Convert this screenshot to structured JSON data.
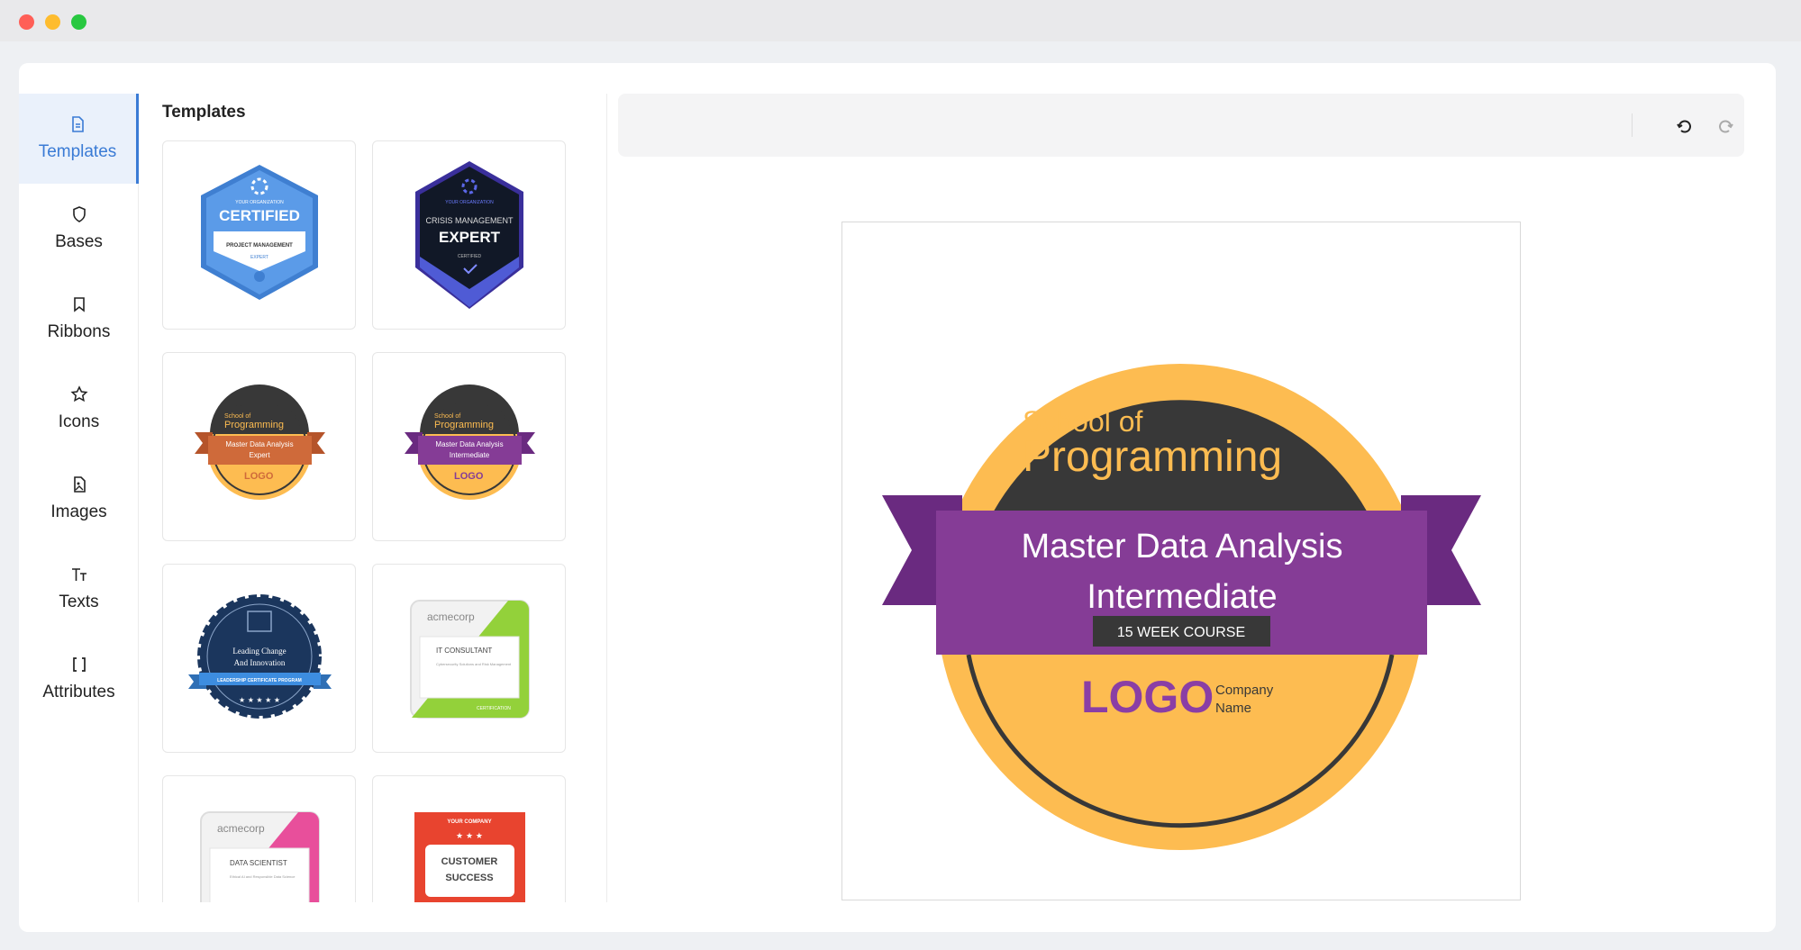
{
  "sidebar": {
    "items": [
      {
        "label": "Templates",
        "icon": "file-icon",
        "active": true
      },
      {
        "label": "Bases",
        "icon": "shield-icon"
      },
      {
        "label": "Ribbons",
        "icon": "bookmark-icon"
      },
      {
        "label": "Icons",
        "icon": "star-icon"
      },
      {
        "label": "Images",
        "icon": "image-file-icon"
      },
      {
        "label": "Texts",
        "icon": "text-size-icon"
      },
      {
        "label": "Attributes",
        "icon": "brackets-icon"
      }
    ]
  },
  "panel": {
    "title": "Templates",
    "templates": [
      {
        "org": "YOUR ORGANIZATION",
        "title": "CERTIFIED",
        "sub": "PROJECT MANAGEMENT",
        "level": "EXPERT"
      },
      {
        "org": "YOUR ORGANIZATION",
        "top": "CRISIS MANAGEMENT",
        "title": "EXPERT",
        "sub": "CERTIFIED"
      },
      {
        "school": "School of",
        "prog": "Programming",
        "line1": "Master Data Analysis",
        "line2": "Expert",
        "logo": "LOGO"
      },
      {
        "school": "School of",
        "prog": "Programming",
        "line1": "Master Data Analysis",
        "line2": "Intermediate",
        "logo": "LOGO"
      },
      {
        "line1": "Leading Change",
        "line2": "And Innovation",
        "ribbon": "LEADERSHIP CERTIFICATE PROGRAM"
      },
      {
        "brand": "acmecorp",
        "title": "IT CONSULTANT",
        "desc": "Cybersecurity Solutions and Risk Management",
        "foot": "CERTIFICATION"
      },
      {
        "brand": "acmecorp",
        "title": "DATA SCIENTIST",
        "desc": "Ethical AI and Responsible Data Science"
      },
      {
        "company": "YOUR COMPANY",
        "line1": "CUSTOMER",
        "line2": "SUCCESS"
      }
    ]
  },
  "badge": {
    "school": "School of",
    "program": "Programming",
    "title_line1": "Master Data Analysis",
    "title_line2": "Intermediate",
    "course": "15 WEEK COURSE",
    "logo": "LOGO",
    "company_line1": "Company",
    "company_line2": "Name"
  },
  "colors": {
    "accent": "#3a7bd5",
    "badge_dark": "#383838",
    "badge_yellow": "#fdbc51",
    "ribbon_purple": "#853c96",
    "ribbon_purple_dark": "#6a2a80",
    "logo_purple": "#8a3ea5"
  }
}
